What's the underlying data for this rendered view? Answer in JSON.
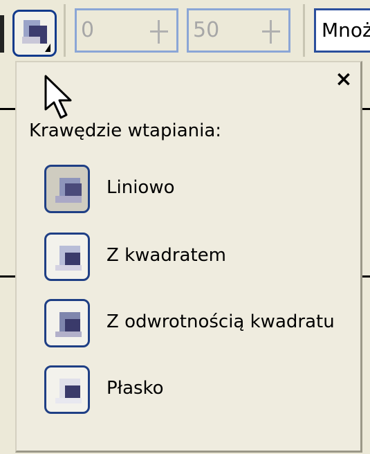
{
  "toolbar": {
    "spin1_value": "0",
    "spin2_value": "50",
    "blend_mode_value": "Mnoż"
  },
  "popup": {
    "title": "Krawędzie wtapiania:",
    "close_symbol": "×",
    "options": [
      {
        "label": "Liniowo",
        "selected": true
      },
      {
        "label": "Z kwadratem",
        "selected": false
      },
      {
        "label": "Z odwrotnością kwadratu",
        "selected": false
      },
      {
        "label": "Płasko",
        "selected": false
      }
    ]
  },
  "icons": {
    "feather_mode": "feather-edge-icon",
    "cursor": "mouse-pointer-icon",
    "close": "close-icon"
  },
  "colors": {
    "border_blue": "#1f3f85",
    "window_bg": "#ece9d8"
  }
}
